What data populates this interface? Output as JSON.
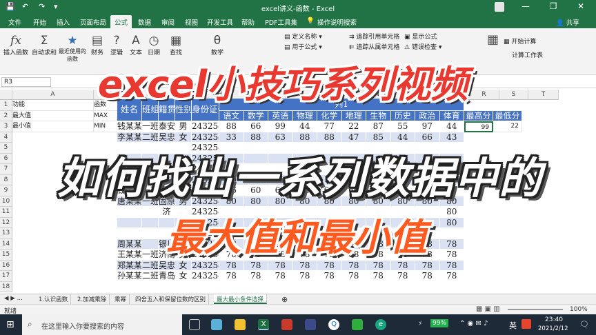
{
  "window": {
    "title": "excel讲义-函数 - Excel",
    "signin_label": "登录",
    "controls": [
      "—",
      "❐",
      "✕"
    ]
  },
  "quick_access": [
    "💾",
    "↶",
    "↷",
    "▾"
  ],
  "menu": {
    "tabs": [
      "文件",
      "开始",
      "插入",
      "页面布局",
      "公式",
      "数据",
      "审阅",
      "视图",
      "开发工具",
      "帮助",
      "PDF工具集",
      "操作说明搜索"
    ],
    "active": "公式",
    "share": "共享"
  },
  "ribbon": {
    "big_buttons": [
      {
        "icon": "fx",
        "label": "插入函数"
      },
      {
        "icon": "Σ",
        "label": "自动求和"
      },
      {
        "icon": "★",
        "label": "最近使用的函数"
      },
      {
        "icon": "▤",
        "label": "财务"
      },
      {
        "icon": "?",
        "label": "逻辑"
      },
      {
        "icon": "A",
        "label": "文本"
      },
      {
        "icon": "◷",
        "label": "日期"
      },
      {
        "icon": "▦",
        "label": "查找"
      },
      {
        "icon": "θ",
        "label": "数学"
      }
    ],
    "small_buttons": [
      "定义名称",
      "用于公式",
      "追踪引用单元格",
      "追踪从属单元格",
      "显示公式",
      "错误检查",
      "开始计算",
      "计算工作表"
    ]
  },
  "formula_bar": {
    "name_box": "R3"
  },
  "columns": [
    "A",
    "B",
    "C",
    "D",
    "E",
    "F",
    "G",
    "H",
    "I",
    "J",
    "K",
    "L",
    "M",
    "N",
    "O",
    "P",
    "Q",
    "R",
    "S",
    "T"
  ],
  "rows": [
    "1",
    "2",
    "3",
    "4",
    "5",
    "6",
    "7",
    "8",
    "9",
    "10",
    "11",
    "12",
    "13",
    "14",
    "15",
    "16",
    "17",
    "18"
  ],
  "side_table": {
    "headers": [
      "功能",
      "函数"
    ],
    "rows": [
      [
        "最大值",
        "MAX"
      ],
      [
        "最小值",
        "MIN"
      ]
    ]
  },
  "table": {
    "headers": [
      "姓名",
      "班组",
      "籍贯",
      "性别",
      "身份证号"
    ],
    "group_header": "列1",
    "subjects": [
      "语文",
      "数学",
      "英语",
      "物理",
      "化学",
      "地理",
      "生物",
      "历史",
      "政治",
      "体育"
    ],
    "stat_headers": [
      "最高分",
      "最低分"
    ],
    "rows": [
      [
        "钱某某",
        "一班",
        "泰安",
        "男",
        "2432546",
        "88",
        "66",
        "99",
        "44",
        "77",
        "22",
        "87",
        "55",
        "97",
        "44"
      ],
      [
        "李某某",
        "二班",
        "吴忠",
        "女",
        "2432546",
        "33",
        "88",
        "63",
        "88",
        "88",
        "47",
        "85",
        "44",
        "66",
        "43"
      ],
      [
        "",
        "",
        "",
        "",
        "2432546",
        "",
        "",
        "",
        "",
        "",
        "",
        "",
        "",
        "",
        ""
      ],
      [
        "",
        "",
        "",
        "",
        "2432546",
        "",
        "",
        "",
        "",
        "",
        "",
        "",
        "",
        "",
        ""
      ],
      [
        "",
        "",
        "",
        "",
        "2432546",
        "",
        "",
        "",
        "",
        "",
        "",
        "",
        "",
        "",
        ""
      ],
      [
        "",
        "",
        "",
        "",
        "2432546",
        "80",
        "",
        "",
        "",
        "",
        "",
        "",
        "",
        "",
        ""
      ],
      [
        "钱某某",
        "一班",
        "青岛",
        "女",
        "2432546",
        "66",
        "60",
        "60",
        "60",
        "60",
        "60",
        "60",
        "60",
        "60",
        "60"
      ],
      [
        "唐某某",
        "一班",
        "固原",
        "男",
        "2432546",
        "80",
        "80",
        "80",
        "80",
        "80",
        "80",
        "80",
        "80",
        "80",
        "80"
      ],
      [
        "",
        "",
        "济",
        "",
        "2432546",
        "",
        "",
        "",
        "",
        "",
        "",
        "",
        "",
        "",
        "80"
      ],
      [
        "",
        "",
        "",
        "",
        "2432546",
        "",
        "",
        "",
        "",
        "",
        "",
        "",
        "",
        "",
        "80"
      ],
      [
        "",
        "",
        "",
        "",
        "2432546",
        "",
        "",
        "",
        "",
        "",
        "",
        "",
        "",
        "",
        ""
      ],
      [
        "周某某",
        "",
        "银川",
        "男",
        "2432546",
        "78",
        "78",
        "78",
        "78",
        "78",
        "78",
        "78",
        "78",
        "78",
        "78"
      ],
      [
        "王某某",
        "一班",
        "济南",
        "男",
        "2432546",
        "78",
        "78",
        "78",
        "78",
        "78",
        "78",
        "78",
        "78",
        "78",
        "78"
      ],
      [
        "郑某某",
        "二班",
        "吴忠",
        "女",
        "2432546",
        "78",
        "78",
        "78",
        "78",
        "78",
        "78",
        "78",
        "78",
        "78",
        "78"
      ],
      [
        "孙某某",
        "二班",
        "青岛",
        "女",
        "2432546",
        "78",
        "78",
        "78",
        "78",
        "78",
        "78",
        "78",
        "78",
        "78",
        "78"
      ]
    ],
    "stats": [
      "99",
      "22"
    ]
  },
  "sheet_tabs": [
    "1.认识函数",
    "2.加减乘除",
    "乘幂",
    "四舍五入和保留位数的区别",
    "最大最小条件选择"
  ],
  "active_sheet": "最大最小条件选择",
  "status": {
    "left": "就绪",
    "zoom": "100%"
  },
  "taskbar": {
    "search_placeholder": "在这里输入你要搜索的内容",
    "battery": "99%",
    "ime": "英",
    "time": "23:40",
    "date": "2021/2/12"
  },
  "overlay": {
    "line1": "excel小技巧系列视频",
    "line2": "如何找出一系列数据中的",
    "line3": "最大值和最小值"
  },
  "colors": {
    "excel_green": "#217346",
    "table_header": "#4472c4",
    "table_stripe": "#d9e1f2",
    "caption_red": "#e8382f",
    "caption_orange": "#ff5a1f"
  }
}
